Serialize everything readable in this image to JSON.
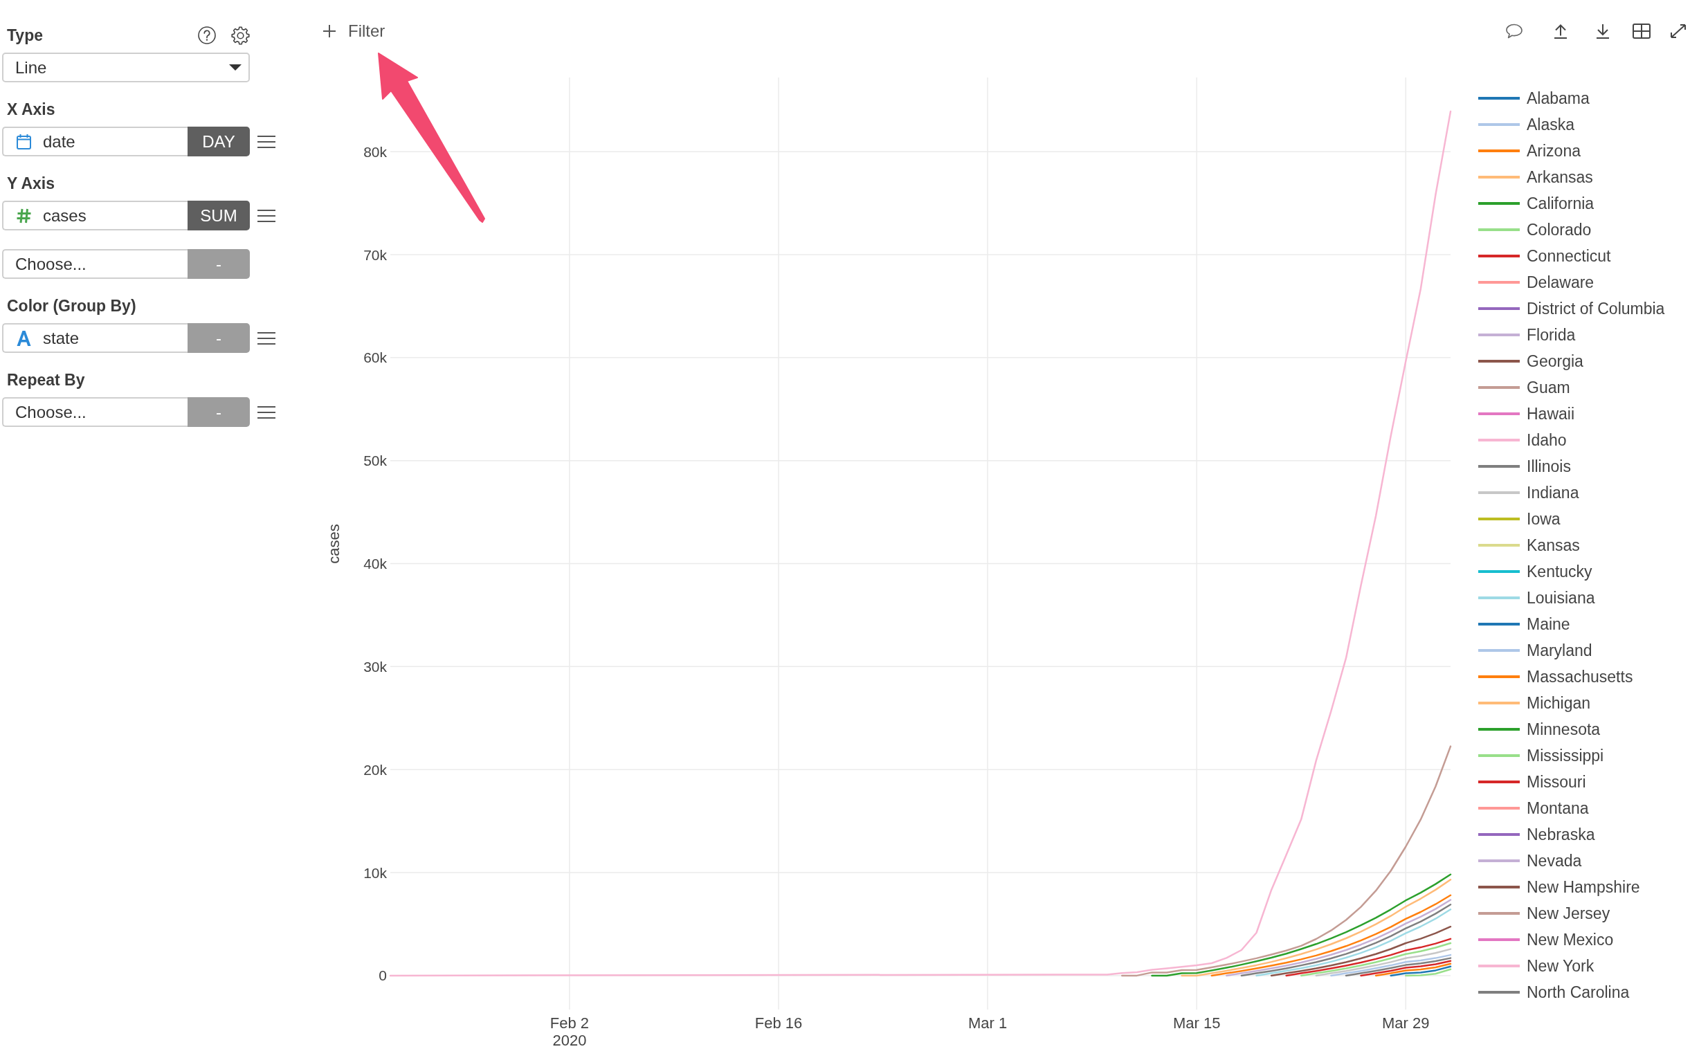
{
  "config_panel": {
    "sections": [
      {
        "label": "Type",
        "kind": "chart_type",
        "value": "Line"
      },
      {
        "label": "X Axis",
        "kind": "columns",
        "rows": [
          {
            "kind": "date",
            "value": "date",
            "function": {
              "label": "DAY",
              "active": true
            },
            "menu": true
          }
        ]
      },
      {
        "label": "Y Axis",
        "kind": "columns",
        "rows": [
          {
            "kind": "number",
            "value": "cases",
            "function": {
              "label": "SUM",
              "active": true
            },
            "menu": true
          },
          {
            "kind": "empty",
            "placeholder": "Choose...",
            "function": {
              "label": "-",
              "active": false
            },
            "menu": false
          }
        ]
      },
      {
        "label": "Color (Group By)",
        "kind": "columns",
        "rows": [
          {
            "kind": "text",
            "value": "state",
            "function": {
              "label": "-",
              "active": false
            },
            "menu": true
          }
        ]
      },
      {
        "label": "Repeat By",
        "kind": "columns",
        "rows": [
          {
            "kind": "empty",
            "placeholder": "Choose...",
            "function": {
              "label": "-",
              "active": false
            },
            "menu": true
          }
        ]
      }
    ]
  },
  "toolbar": {
    "filter_button": "Filter"
  },
  "chart": {
    "chart_data": {
      "type": "line",
      "grid": true,
      "ylabel": "cases",
      "x": [
        "2020-01-21",
        "2020-03-09",
        "2020-03-10",
        "2020-03-11",
        "2020-03-12",
        "2020-03-13",
        "2020-03-14",
        "2020-03-15",
        "2020-03-16",
        "2020-03-17",
        "2020-03-18",
        "2020-03-19",
        "2020-03-20",
        "2020-03-21",
        "2020-03-22",
        "2020-03-23",
        "2020-03-24",
        "2020-03-25",
        "2020-03-26",
        "2020-03-27",
        "2020-03-28",
        "2020-03-29",
        "2020-03-30",
        "2020-03-31",
        "2020-04-01"
      ],
      "xlim": [
        "2020-01-21",
        "2020-04-01"
      ],
      "ylim": [
        -3300,
        87200
      ],
      "xticks": [
        {
          "value": "2020-02-02",
          "label": "Feb 2\n2020"
        },
        {
          "value": "2020-02-16",
          "label": "Feb 16"
        },
        {
          "value": "2020-03-01",
          "label": "Mar 1"
        },
        {
          "value": "2020-03-15",
          "label": "Mar 15"
        },
        {
          "value": "2020-03-29",
          "label": "Mar 29"
        }
      ],
      "yticks": [
        {
          "value": 0,
          "label": "0"
        },
        {
          "value": 10000,
          "label": "10k"
        },
        {
          "value": 20000,
          "label": "20k"
        },
        {
          "value": 30000,
          "label": "30k"
        },
        {
          "value": 40000,
          "label": "40k"
        },
        {
          "value": 50000,
          "label": "50k"
        },
        {
          "value": 60000,
          "label": "60k"
        },
        {
          "value": 70000,
          "label": "70k"
        },
        {
          "value": 80000,
          "label": "80k"
        }
      ],
      "series": [
        {
          "name": "Alabama",
          "color": "#1f77b4",
          "values": [
            null,
            null,
            null,
            null,
            null,
            null,
            null,
            null,
            null,
            null,
            null,
            null,
            null,
            null,
            null,
            null,
            null,
            null,
            null,
            null,
            0,
            230,
            300,
            500,
            880
          ]
        },
        {
          "name": "Alaska",
          "color": "#aec7e8",
          "values": [
            null,
            null,
            null,
            null,
            null,
            null,
            null,
            null,
            null,
            null,
            null,
            null,
            null,
            null,
            null,
            null,
            null,
            null,
            null,
            null,
            null,
            null,
            null,
            null,
            null
          ]
        },
        {
          "name": "Arizona",
          "color": "#ff7f0e",
          "values": [
            null,
            null,
            null,
            null,
            null,
            null,
            null,
            null,
            null,
            null,
            null,
            null,
            null,
            null,
            null,
            null,
            null,
            null,
            null,
            0,
            230,
            490,
            590,
            800,
            1150
          ]
        },
        {
          "name": "Arkansas",
          "color": "#ffbb78",
          "values": [
            null,
            null,
            null,
            null,
            null,
            null,
            null,
            null,
            null,
            null,
            null,
            null,
            null,
            null,
            null,
            null,
            null,
            null,
            null,
            null,
            null,
            null,
            null,
            null,
            null
          ]
        },
        {
          "name": "California",
          "color": "#2ca02c",
          "values": [
            null,
            null,
            null,
            null,
            0,
            0,
            230,
            240,
            490,
            760,
            1060,
            1380,
            1740,
            2130,
            2580,
            3060,
            3610,
            4210,
            4880,
            5610,
            6420,
            7300,
            8050,
            8890,
            9820
          ]
        },
        {
          "name": "Colorado",
          "color": "#98df8a",
          "values": [
            null,
            null,
            null,
            null,
            null,
            null,
            null,
            null,
            null,
            null,
            null,
            null,
            null,
            null,
            0,
            220,
            450,
            700,
            980,
            1300,
            1670,
            2090,
            2360,
            2710,
            3150
          ]
        },
        {
          "name": "Connecticut",
          "color": "#d62728",
          "values": [
            null,
            null,
            null,
            null,
            null,
            null,
            null,
            null,
            null,
            null,
            null,
            null,
            null,
            0,
            220,
            450,
            700,
            970,
            1270,
            1610,
            2000,
            2450,
            2740,
            3110,
            3560
          ]
        },
        {
          "name": "Delaware",
          "color": "#ff9896",
          "values": [
            null,
            null,
            null,
            null,
            null,
            null,
            null,
            null,
            null,
            null,
            null,
            null,
            null,
            null,
            null,
            null,
            null,
            null,
            null,
            null,
            null,
            null,
            null,
            null,
            null
          ]
        },
        {
          "name": "District of Columbia",
          "color": "#9467bd",
          "values": [
            null,
            null,
            null,
            null,
            null,
            null,
            null,
            null,
            null,
            null,
            null,
            null,
            null,
            null,
            null,
            null,
            null,
            null,
            null,
            null,
            null,
            null,
            null,
            null,
            null
          ]
        },
        {
          "name": "Florida",
          "color": "#c5b0d5",
          "values": [
            null,
            null,
            null,
            null,
            null,
            null,
            null,
            null,
            null,
            0,
            220,
            450,
            700,
            970,
            1270,
            1620,
            2020,
            2480,
            3000,
            3600,
            4280,
            5050,
            5710,
            6470,
            7350
          ]
        },
        {
          "name": "Georgia",
          "color": "#8c564b",
          "values": [
            null,
            null,
            null,
            null,
            null,
            null,
            null,
            null,
            null,
            null,
            null,
            null,
            0,
            220,
            450,
            700,
            980,
            1300,
            1670,
            2090,
            2580,
            3150,
            3580,
            4110,
            4750
          ]
        },
        {
          "name": "Guam",
          "color": "#c49c94",
          "values": [
            null,
            null,
            null,
            null,
            null,
            null,
            null,
            null,
            null,
            null,
            null,
            null,
            null,
            null,
            null,
            null,
            null,
            null,
            null,
            null,
            null,
            null,
            null,
            null,
            null
          ]
        },
        {
          "name": "Hawaii",
          "color": "#e377c2",
          "values": [
            null,
            null,
            null,
            null,
            null,
            null,
            null,
            null,
            null,
            null,
            null,
            null,
            null,
            null,
            null,
            null,
            null,
            null,
            null,
            null,
            null,
            null,
            null,
            null,
            null
          ]
        },
        {
          "name": "Idaho",
          "color": "#f7b6d2",
          "values": [
            null,
            null,
            null,
            null,
            null,
            null,
            null,
            null,
            null,
            null,
            null,
            null,
            null,
            null,
            null,
            null,
            null,
            null,
            null,
            null,
            null,
            null,
            null,
            null,
            null
          ]
        },
        {
          "name": "Illinois",
          "color": "#7f7f7f",
          "values": [
            null,
            null,
            null,
            null,
            null,
            null,
            null,
            null,
            null,
            null,
            0,
            220,
            450,
            700,
            990,
            1300,
            1670,
            2100,
            2600,
            3170,
            3830,
            4590,
            5240,
            6010,
            6900
          ]
        },
        {
          "name": "Indiana",
          "color": "#c7c7c7",
          "values": [
            null,
            null,
            null,
            null,
            null,
            null,
            null,
            null,
            null,
            null,
            null,
            null,
            null,
            null,
            null,
            0,
            220,
            450,
            710,
            990,
            1310,
            1690,
            1910,
            2190,
            2570
          ]
        },
        {
          "name": "Iowa",
          "color": "#bcbd22",
          "values": [
            null,
            null,
            null,
            null,
            null,
            null,
            null,
            null,
            null,
            null,
            null,
            null,
            null,
            null,
            null,
            null,
            null,
            null,
            null,
            null,
            null,
            null,
            null,
            null,
            null
          ]
        },
        {
          "name": "Kansas",
          "color": "#dbdb8d",
          "values": [
            null,
            null,
            null,
            null,
            null,
            null,
            null,
            null,
            null,
            null,
            null,
            null,
            null,
            null,
            null,
            null,
            null,
            null,
            null,
            null,
            null,
            null,
            null,
            null,
            null
          ]
        },
        {
          "name": "Kentucky",
          "color": "#17becf",
          "values": [
            null,
            null,
            null,
            null,
            null,
            null,
            null,
            null,
            null,
            null,
            null,
            null,
            null,
            null,
            null,
            null,
            null,
            null,
            null,
            null,
            null,
            null,
            null,
            null,
            null
          ]
        },
        {
          "name": "Louisiana",
          "color": "#9edae5",
          "values": [
            null,
            null,
            null,
            null,
            null,
            null,
            null,
            null,
            null,
            null,
            null,
            0,
            220,
            460,
            710,
            1000,
            1340,
            1740,
            2200,
            2740,
            3380,
            4120,
            4760,
            5520,
            6420
          ]
        },
        {
          "name": "Maine",
          "color": "#1f77b4",
          "values": [
            null,
            null,
            null,
            null,
            null,
            null,
            null,
            null,
            null,
            null,
            null,
            null,
            null,
            null,
            null,
            null,
            null,
            null,
            null,
            null,
            null,
            null,
            null,
            null,
            null
          ]
        },
        {
          "name": "Maryland",
          "color": "#aec7e8",
          "values": [
            null,
            null,
            null,
            null,
            null,
            null,
            null,
            null,
            null,
            null,
            null,
            null,
            null,
            null,
            null,
            null,
            0,
            220,
            450,
            710,
            990,
            1320,
            1480,
            1700,
            2000
          ]
        },
        {
          "name": "Massachusetts",
          "color": "#ff7f0e",
          "values": [
            null,
            null,
            null,
            null,
            null,
            null,
            null,
            null,
            0,
            220,
            450,
            690,
            960,
            1250,
            1580,
            1950,
            2380,
            2860,
            3410,
            4030,
            4720,
            5510,
            6170,
            6930,
            7800
          ]
        },
        {
          "name": "Michigan",
          "color": "#ffbb78",
          "values": [
            null,
            null,
            null,
            null,
            null,
            null,
            0,
            0,
            230,
            470,
            730,
            1010,
            1330,
            1690,
            2090,
            2540,
            3050,
            3620,
            4270,
            4990,
            5790,
            6690,
            7460,
            8330,
            9320
          ]
        },
        {
          "name": "Minnesota",
          "color": "#2ca02c",
          "values": [
            null,
            null,
            null,
            null,
            null,
            null,
            null,
            null,
            null,
            null,
            null,
            null,
            null,
            null,
            null,
            null,
            null,
            null,
            null,
            null,
            null,
            null,
            null,
            null,
            null
          ]
        },
        {
          "name": "Mississippi",
          "color": "#98df8a",
          "values": [
            null,
            null,
            null,
            null,
            null,
            null,
            null,
            null,
            null,
            null,
            null,
            null,
            null,
            null,
            null,
            null,
            null,
            null,
            null,
            null,
            null,
            0,
            20,
            180,
            620
          ]
        },
        {
          "name": "Missouri",
          "color": "#d62728",
          "values": [
            null,
            null,
            null,
            null,
            null,
            null,
            null,
            null,
            null,
            null,
            null,
            null,
            null,
            null,
            null,
            null,
            null,
            null,
            0,
            220,
            470,
            760,
            890,
            1100,
            1420
          ]
        },
        {
          "name": "Montana",
          "color": "#ff9896",
          "values": [
            null,
            null,
            null,
            null,
            null,
            null,
            null,
            null,
            null,
            null,
            null,
            null,
            null,
            null,
            null,
            null,
            null,
            null,
            null,
            null,
            null,
            null,
            null,
            null,
            null
          ]
        },
        {
          "name": "Nebraska",
          "color": "#9467bd",
          "values": [
            null,
            null,
            null,
            null,
            null,
            null,
            null,
            null,
            null,
            null,
            null,
            null,
            null,
            null,
            null,
            null,
            null,
            null,
            null,
            null,
            null,
            null,
            null,
            null,
            null
          ]
        },
        {
          "name": "Nevada",
          "color": "#c5b0d5",
          "values": [
            null,
            null,
            null,
            null,
            null,
            null,
            null,
            null,
            null,
            null,
            null,
            null,
            null,
            null,
            null,
            null,
            null,
            null,
            null,
            null,
            null,
            null,
            null,
            null,
            null
          ]
        },
        {
          "name": "New Hampshire",
          "color": "#8c564b",
          "values": [
            null,
            null,
            null,
            null,
            null,
            null,
            null,
            null,
            null,
            null,
            null,
            null,
            null,
            null,
            null,
            null,
            null,
            null,
            null,
            null,
            null,
            null,
            null,
            null,
            null
          ]
        },
        {
          "name": "New Jersey",
          "color": "#c49c94",
          "values": [
            null,
            null,
            0,
            0,
            300,
            300,
            530,
            540,
            790,
            1060,
            1360,
            1680,
            2040,
            2430,
            2890,
            3550,
            4380,
            5400,
            6670,
            8240,
            10170,
            12520,
            15150,
            18370,
            22260
          ]
        },
        {
          "name": "New Mexico",
          "color": "#e377c2",
          "values": [
            null,
            null,
            null,
            null,
            null,
            null,
            null,
            null,
            null,
            null,
            null,
            null,
            null,
            null,
            null,
            null,
            null,
            null,
            null,
            null,
            null,
            null,
            null,
            null,
            null
          ]
        },
        {
          "name": "New York",
          "color": "#f7b6d2",
          "values": [
            0,
            100,
            250,
            330,
            560,
            700,
            850,
            1000,
            1200,
            1710,
            2480,
            4160,
            8310,
            11710,
            15170,
            20880,
            25680,
            30840,
            37880,
            44640,
            52410,
            59650,
            66660,
            75830,
            83900
          ]
        },
        {
          "name": "North Carolina",
          "color": "#7f7f7f",
          "values": [
            null,
            null,
            null,
            null,
            null,
            null,
            null,
            null,
            null,
            null,
            null,
            null,
            null,
            null,
            null,
            null,
            null,
            0,
            220,
            460,
            730,
            1030,
            1180,
            1400,
            1700
          ]
        }
      ]
    }
  }
}
